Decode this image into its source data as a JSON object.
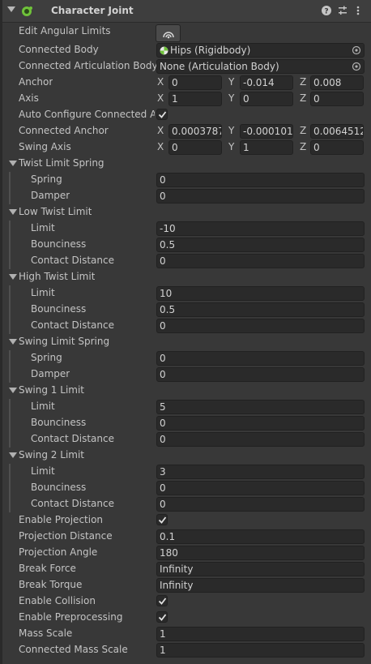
{
  "component": {
    "title": "Character Joint"
  },
  "rows": {
    "edit_angular_limits": "Edit Angular Limits",
    "connected_body": {
      "label": "Connected Body",
      "value": "Hips (Rigidbody)"
    },
    "connected_articulation_body": {
      "label": "Connected Articulation Body",
      "value": "None (Articulation Body)"
    },
    "anchor": {
      "label": "Anchor",
      "x": "0",
      "y": "-0.014",
      "z": "0.008"
    },
    "axis": {
      "label": "Axis",
      "x": "1",
      "y": "0",
      "z": "0"
    },
    "auto_configure": {
      "label": "Auto Configure Connected Anchor",
      "checked": true
    },
    "connected_anchor": {
      "label": "Connected Anchor",
      "x": "0.0003787",
      "y": "-0.000101",
      "z": "0.0064512"
    },
    "swing_axis": {
      "label": "Swing Axis",
      "x": "0",
      "y": "1",
      "z": "0"
    }
  },
  "axis_labels": {
    "x": "X",
    "y": "Y",
    "z": "Z"
  },
  "twist_limit_spring": {
    "title": "Twist Limit Spring",
    "spring_label": "Spring",
    "spring": "0",
    "damper_label": "Damper",
    "damper": "0"
  },
  "low_twist_limit": {
    "title": "Low Twist Limit",
    "limit_label": "Limit",
    "limit": "-10",
    "bounciness_label": "Bounciness",
    "bounciness": "0.5",
    "contact_label": "Contact Distance",
    "contact": "0"
  },
  "high_twist_limit": {
    "title": "High Twist Limit",
    "limit_label": "Limit",
    "limit": "10",
    "bounciness_label": "Bounciness",
    "bounciness": "0.5",
    "contact_label": "Contact Distance",
    "contact": "0"
  },
  "swing_limit_spring": {
    "title": "Swing Limit Spring",
    "spring_label": "Spring",
    "spring": "0",
    "damper_label": "Damper",
    "damper": "0"
  },
  "swing1_limit": {
    "title": "Swing 1 Limit",
    "limit_label": "Limit",
    "limit": "5",
    "bounciness_label": "Bounciness",
    "bounciness": "0",
    "contact_label": "Contact Distance",
    "contact": "0"
  },
  "swing2_limit": {
    "title": "Swing 2 Limit",
    "limit_label": "Limit",
    "limit": "3",
    "bounciness_label": "Bounciness",
    "bounciness": "0",
    "contact_label": "Contact Distance",
    "contact": "0"
  },
  "bottom": {
    "enable_projection": {
      "label": "Enable Projection",
      "checked": true
    },
    "projection_distance": {
      "label": "Projection Distance",
      "value": "0.1"
    },
    "projection_angle": {
      "label": "Projection Angle",
      "value": "180"
    },
    "break_force": {
      "label": "Break Force",
      "value": "Infinity"
    },
    "break_torque": {
      "label": "Break Torque",
      "value": "Infinity"
    },
    "enable_collision": {
      "label": "Enable Collision",
      "checked": true
    },
    "enable_preprocessing": {
      "label": "Enable Preprocessing",
      "checked": true
    },
    "mass_scale": {
      "label": "Mass Scale",
      "value": "1"
    },
    "connected_mass_scale": {
      "label": "Connected Mass Scale",
      "value": "1"
    }
  },
  "icons": {
    "component": "character-joint-icon",
    "help": "help-icon",
    "presets": "presets-icon",
    "menu": "kebab-menu-icon",
    "edit_angular": "edit-angular-limits-icon",
    "rigidbody": "rigidbody-icon",
    "picker": "object-picker-icon",
    "check": "checkmark-icon"
  },
  "colors": {
    "panel": "#383838",
    "field": "#2a2a2a",
    "text": "#c4c4c4",
    "accent_green": "#6fc23a"
  }
}
